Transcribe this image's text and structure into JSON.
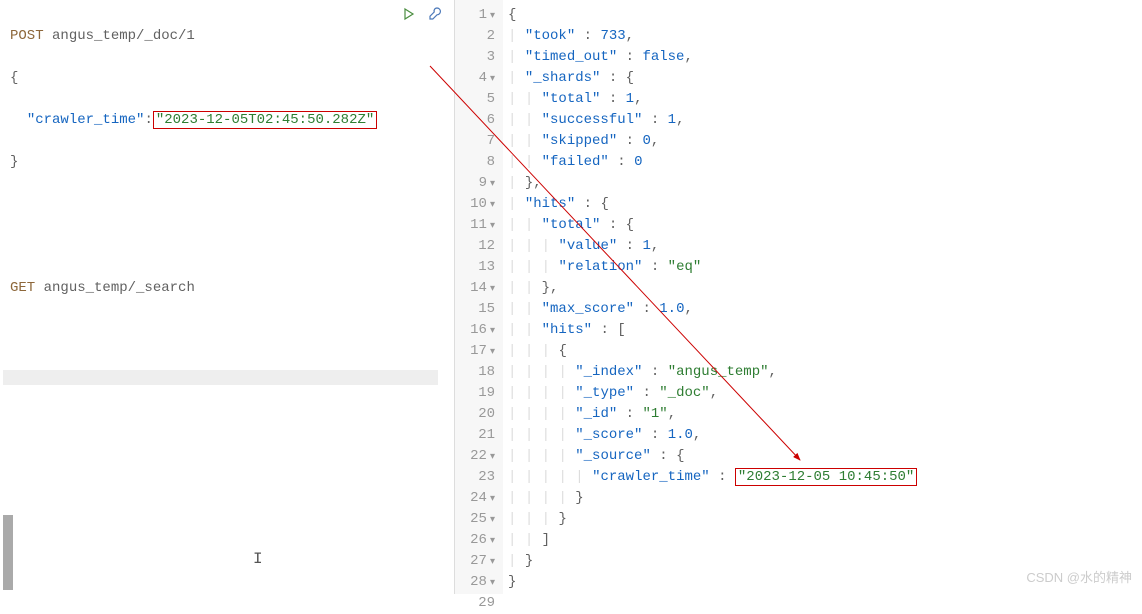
{
  "left_editor": {
    "line1": {
      "method": "POST",
      "path": " angus_temp/_doc/1"
    },
    "line2": "{",
    "line3": {
      "indent": "  ",
      "key": "\"crawler_time\"",
      "colon": ":",
      "value": "\"2023-12-05T02:45:50.282Z\""
    },
    "line4": "}",
    "line5": "",
    "line6": "",
    "line7": {
      "method": "GET",
      "path": " angus_temp/_search"
    }
  },
  "right_editor": {
    "lines": [
      {
        "num": "1",
        "fold": true,
        "content": [
          {
            "t": "punct",
            "v": "{"
          }
        ]
      },
      {
        "num": "2",
        "content": [
          {
            "t": "indent",
            "v": "  "
          },
          {
            "t": "prop",
            "v": "\"took\""
          },
          {
            "t": "colon",
            "v": " : "
          },
          {
            "t": "number",
            "v": "733"
          },
          {
            "t": "punct",
            "v": ","
          }
        ]
      },
      {
        "num": "3",
        "content": [
          {
            "t": "indent",
            "v": "  "
          },
          {
            "t": "prop",
            "v": "\"timed_out\""
          },
          {
            "t": "colon",
            "v": " : "
          },
          {
            "t": "bool",
            "v": "false"
          },
          {
            "t": "punct",
            "v": ","
          }
        ]
      },
      {
        "num": "4",
        "fold": true,
        "content": [
          {
            "t": "indent",
            "v": "  "
          },
          {
            "t": "prop",
            "v": "\"_shards\""
          },
          {
            "t": "colon",
            "v": " : "
          },
          {
            "t": "punct",
            "v": "{"
          }
        ]
      },
      {
        "num": "5",
        "content": [
          {
            "t": "indent",
            "v": "    "
          },
          {
            "t": "prop",
            "v": "\"total\""
          },
          {
            "t": "colon",
            "v": " : "
          },
          {
            "t": "number",
            "v": "1"
          },
          {
            "t": "punct",
            "v": ","
          }
        ]
      },
      {
        "num": "6",
        "content": [
          {
            "t": "indent",
            "v": "    "
          },
          {
            "t": "prop",
            "v": "\"successful\""
          },
          {
            "t": "colon",
            "v": " : "
          },
          {
            "t": "number",
            "v": "1"
          },
          {
            "t": "punct",
            "v": ","
          }
        ]
      },
      {
        "num": "7",
        "content": [
          {
            "t": "indent",
            "v": "    "
          },
          {
            "t": "prop",
            "v": "\"skipped\""
          },
          {
            "t": "colon",
            "v": " : "
          },
          {
            "t": "number",
            "v": "0"
          },
          {
            "t": "punct",
            "v": ","
          }
        ]
      },
      {
        "num": "8",
        "content": [
          {
            "t": "indent",
            "v": "    "
          },
          {
            "t": "prop",
            "v": "\"failed\""
          },
          {
            "t": "colon",
            "v": " : "
          },
          {
            "t": "number",
            "v": "0"
          }
        ]
      },
      {
        "num": "9",
        "fold": true,
        "content": [
          {
            "t": "indent",
            "v": "  "
          },
          {
            "t": "punct",
            "v": "},"
          }
        ]
      },
      {
        "num": "10",
        "fold": true,
        "content": [
          {
            "t": "indent",
            "v": "  "
          },
          {
            "t": "prop",
            "v": "\"hits\""
          },
          {
            "t": "colon",
            "v": " : "
          },
          {
            "t": "punct",
            "v": "{"
          }
        ]
      },
      {
        "num": "11",
        "fold": true,
        "content": [
          {
            "t": "indent",
            "v": "    "
          },
          {
            "t": "prop",
            "v": "\"total\""
          },
          {
            "t": "colon",
            "v": " : "
          },
          {
            "t": "punct",
            "v": "{"
          }
        ]
      },
      {
        "num": "12",
        "content": [
          {
            "t": "indent",
            "v": "      "
          },
          {
            "t": "prop",
            "v": "\"value\""
          },
          {
            "t": "colon",
            "v": " : "
          },
          {
            "t": "number",
            "v": "1"
          },
          {
            "t": "punct",
            "v": ","
          }
        ]
      },
      {
        "num": "13",
        "content": [
          {
            "t": "indent",
            "v": "      "
          },
          {
            "t": "prop",
            "v": "\"relation\""
          },
          {
            "t": "colon",
            "v": " : "
          },
          {
            "t": "string",
            "v": "\"eq\""
          }
        ]
      },
      {
        "num": "14",
        "fold": true,
        "content": [
          {
            "t": "indent",
            "v": "    "
          },
          {
            "t": "punct",
            "v": "},"
          }
        ]
      },
      {
        "num": "15",
        "content": [
          {
            "t": "indent",
            "v": "    "
          },
          {
            "t": "prop",
            "v": "\"max_score\""
          },
          {
            "t": "colon",
            "v": " : "
          },
          {
            "t": "number",
            "v": "1.0"
          },
          {
            "t": "punct",
            "v": ","
          }
        ]
      },
      {
        "num": "16",
        "fold": true,
        "content": [
          {
            "t": "indent",
            "v": "    "
          },
          {
            "t": "prop",
            "v": "\"hits\""
          },
          {
            "t": "colon",
            "v": " : "
          },
          {
            "t": "punct",
            "v": "["
          }
        ]
      },
      {
        "num": "17",
        "fold": true,
        "content": [
          {
            "t": "indent",
            "v": "      "
          },
          {
            "t": "punct",
            "v": "{"
          }
        ]
      },
      {
        "num": "18",
        "content": [
          {
            "t": "indent",
            "v": "        "
          },
          {
            "t": "prop",
            "v": "\"_index\""
          },
          {
            "t": "colon",
            "v": " : "
          },
          {
            "t": "string",
            "v": "\"angus_temp\""
          },
          {
            "t": "punct",
            "v": ","
          }
        ]
      },
      {
        "num": "19",
        "content": [
          {
            "t": "indent",
            "v": "        "
          },
          {
            "t": "prop",
            "v": "\"_type\""
          },
          {
            "t": "colon",
            "v": " : "
          },
          {
            "t": "string",
            "v": "\"_doc\""
          },
          {
            "t": "punct",
            "v": ","
          }
        ]
      },
      {
        "num": "20",
        "content": [
          {
            "t": "indent",
            "v": "        "
          },
          {
            "t": "prop",
            "v": "\"_id\""
          },
          {
            "t": "colon",
            "v": " : "
          },
          {
            "t": "string",
            "v": "\"1\""
          },
          {
            "t": "punct",
            "v": ","
          }
        ]
      },
      {
        "num": "21",
        "content": [
          {
            "t": "indent",
            "v": "        "
          },
          {
            "t": "prop",
            "v": "\"_score\""
          },
          {
            "t": "colon",
            "v": " : "
          },
          {
            "t": "number",
            "v": "1.0"
          },
          {
            "t": "punct",
            "v": ","
          }
        ]
      },
      {
        "num": "22",
        "fold": true,
        "content": [
          {
            "t": "indent",
            "v": "        "
          },
          {
            "t": "prop",
            "v": "\"_source\""
          },
          {
            "t": "colon",
            "v": " : "
          },
          {
            "t": "punct",
            "v": "{"
          }
        ]
      },
      {
        "num": "23",
        "content": [
          {
            "t": "indent",
            "v": "          "
          },
          {
            "t": "prop",
            "v": "\"crawler_time\""
          },
          {
            "t": "colon",
            "v": " : "
          },
          {
            "t": "string",
            "v": "\"2023-12-05 10:45:50\"",
            "highlight": true
          }
        ]
      },
      {
        "num": "24",
        "fold": true,
        "content": [
          {
            "t": "indent",
            "v": "        "
          },
          {
            "t": "punct",
            "v": "}"
          }
        ]
      },
      {
        "num": "25",
        "fold": true,
        "content": [
          {
            "t": "indent",
            "v": "      "
          },
          {
            "t": "punct",
            "v": "}"
          }
        ]
      },
      {
        "num": "26",
        "fold": true,
        "content": [
          {
            "t": "indent",
            "v": "    "
          },
          {
            "t": "punct",
            "v": "]"
          }
        ]
      },
      {
        "num": "27",
        "fold": true,
        "content": [
          {
            "t": "indent",
            "v": "  "
          },
          {
            "t": "punct",
            "v": "}"
          }
        ]
      },
      {
        "num": "28",
        "fold": true,
        "content": [
          {
            "t": "punct",
            "v": "}"
          }
        ]
      },
      {
        "num": "29",
        "content": []
      }
    ]
  },
  "watermark": "CSDN @水的精神"
}
